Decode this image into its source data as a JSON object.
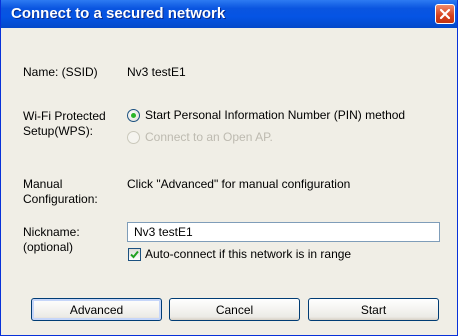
{
  "window": {
    "title": "Connect to a secured network"
  },
  "fields": {
    "name_label": "Name: (SSID)",
    "name_value": "Nv3 testE1",
    "wps_label": "Wi-Fi Protected Setup(WPS):",
    "wps_options": [
      {
        "label": "Start Personal Information Number (PIN) method",
        "selected": true,
        "enabled": true
      },
      {
        "label": "Connect to an Open AP.",
        "selected": false,
        "enabled": false
      }
    ],
    "manual_label": "Manual Configuration:",
    "manual_text": "Click \"Advanced\" for manual configuration",
    "nickname_label": "Nickname: (optional)",
    "nickname_value": "Nv3 testE1",
    "autoconnect_label": "Auto-connect if this network is in range",
    "autoconnect_checked": true
  },
  "buttons": {
    "advanced": "Advanced",
    "cancel": "Cancel",
    "start": "Start"
  },
  "colors": {
    "titlebar": "#0554e4",
    "close": "#d6401c",
    "dialog_bg": "#f0eee6",
    "radio_dot": "#2bb628"
  }
}
